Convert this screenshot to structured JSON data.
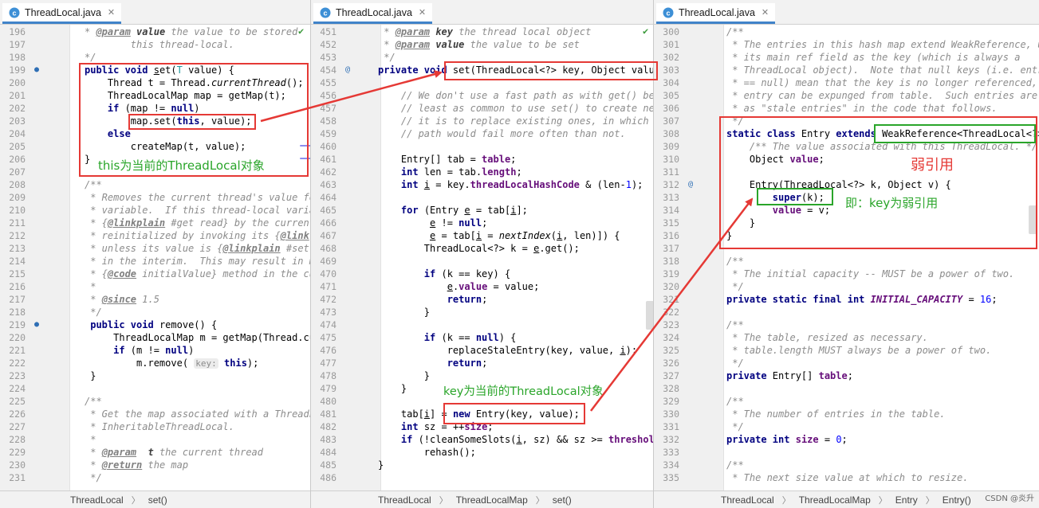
{
  "panes": [
    {
      "tab": {
        "title": "ThreadLocal.java",
        "icon": "java-class-icon"
      },
      "breadcrumb": [
        "ThreadLocal",
        "set()"
      ]
    },
    {
      "tab": {
        "title": "ThreadLocal.java",
        "icon": "java-class-icon"
      },
      "breadcrumb": [
        "ThreadLocal",
        "ThreadLocalMap",
        "set()"
      ]
    },
    {
      "tab": {
        "title": "ThreadLocal.java",
        "icon": "java-class-icon"
      },
      "breadcrumb": [
        "ThreadLocal",
        "ThreadLocalMap",
        "Entry",
        "Entry()"
      ]
    }
  ],
  "annotations": {
    "this_note": "this为当前的ThreadLocal对象",
    "key_note": "key为当前的ThreadLocal对象",
    "weak_ref": "弱引用",
    "key_weak": "即：key为弱引用"
  },
  "watermark": "CSDN @炎升",
  "colors": {
    "highlight_red": "#e53935",
    "highlight_green": "#2aa52a",
    "note_green": "#2aa52a",
    "note_red": "#e53935"
  }
}
